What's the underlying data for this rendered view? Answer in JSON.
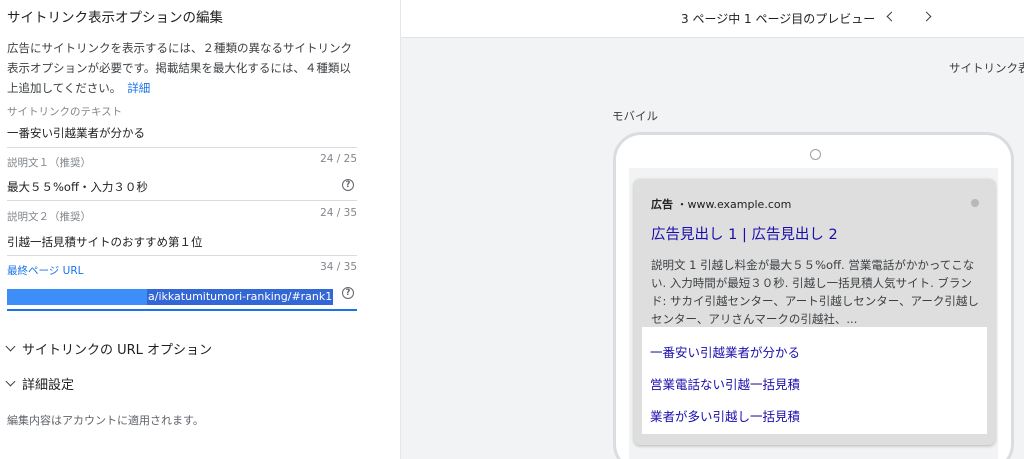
{
  "editor": {
    "title": "サイトリンク表示オプションの編集",
    "intro": "広告にサイトリンクを表示するには、２種類の異なるサイトリンク表示オプションが必要です。掲載結果を最大化するには、４種類以上追加してください。",
    "details_link": "詳細",
    "sitelink_text": {
      "label": "サイトリンクのテキスト",
      "value": "一番安い引越業者が分かる"
    },
    "desc1": {
      "label": "説明文１（推奨）",
      "counter": "24 / 25",
      "value": "最大５５%off・入力３０秒"
    },
    "desc2": {
      "label": "説明文２（推奨）",
      "counter": "24 / 35",
      "value": "引越一括見積サイトのおすすめ第１位"
    },
    "final_url": {
      "label": "最終ページ URL",
      "counter": "34 / 35",
      "value_visible": "a/ikkatumitumori-ranking/#rank1"
    },
    "url_options": "サイトリンクの URL オプション",
    "advanced": "詳細設定",
    "footnote": "編集内容はアカウントに適用されます。"
  },
  "preview": {
    "page_indicator": "3 ページ中 1 ページ目のプレビュー",
    "sitelink_label_cut": "サイトリンク表",
    "mobile_label": "モバイル",
    "ad": {
      "badge": "広告",
      "separator": "・",
      "url": "www.example.com",
      "headline": "広告見出し 1 | 広告見出し 2",
      "description": "説明文 1 引越し料金が最大５５%off. 営業電話がかかってこない. 入力時間が最短３０秒. 引越し一括見積人気サイト. ブランド: サカイ引越センター、アート引越しセンター、アーク引越しセンター、アリさんマークの引越社、...",
      "sitelinks": [
        "一番安い引越業者が分かる",
        "営業電話ない引越一括見積",
        "業者が多い引越し一括見積"
      ]
    }
  },
  "icons": {
    "help": "help-circle-icon",
    "expand": "chevron-down-icon",
    "prev": "chevron-left-icon",
    "next": "chevron-right-icon"
  },
  "colors": {
    "link": "#1a73e8",
    "ad_link": "#1a0dab",
    "selection": "#3367d6",
    "panel_bg": "#f1f3f4"
  }
}
